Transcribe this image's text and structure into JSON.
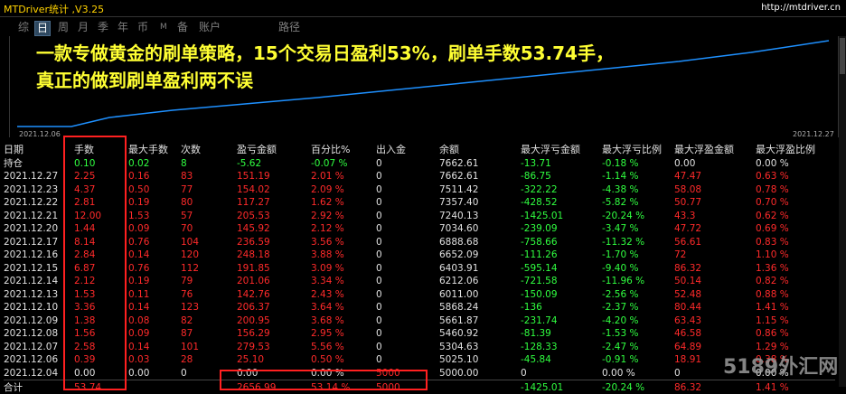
{
  "window": {
    "title": "MTDriver统计 ,V3.25",
    "url": "http://mtdriver.cn"
  },
  "tabs": [
    "综",
    "日",
    "周",
    "月",
    "季",
    "年",
    "币",
    "M",
    "备",
    "账户",
    "路径"
  ],
  "active_tab_index": 1,
  "chart": {
    "start_date": "2021.12.06",
    "end_date": "2021.12.27",
    "line_color": "#1e90ff"
  },
  "banner": {
    "line1": "一款专做黄金的刷单策略，15个交易日盈利53%，刷单手数53.74手，",
    "line2": "真正的做到刷单盈利两不误"
  },
  "table": {
    "headers": [
      "日期",
      "手数",
      "最大手数",
      "次数",
      "盈亏金额",
      "百分比%",
      "出入金",
      "余额",
      "最大浮亏金额",
      "最大浮亏比例",
      "最大浮盈金额",
      "最大浮盈比例"
    ],
    "holding": [
      "持仓",
      "0.10",
      "0.02",
      "8",
      "-5.62",
      "-0.07 %",
      "0",
      "7662.61",
      "-13.71",
      "-0.18 %",
      "0.00",
      "0.00 %"
    ],
    "rows": [
      [
        "2021.12.27",
        "2.25",
        "0.16",
        "83",
        "151.19",
        "2.01 %",
        "0",
        "7662.61",
        "-86.75",
        "-1.14 %",
        "47.47",
        "0.63 %"
      ],
      [
        "2021.12.23",
        "4.37",
        "0.50",
        "77",
        "154.02",
        "2.09 %",
        "0",
        "7511.42",
        "-322.22",
        "-4.38 %",
        "58.08",
        "0.78 %"
      ],
      [
        "2021.12.22",
        "2.81",
        "0.19",
        "80",
        "117.27",
        "1.62 %",
        "0",
        "7357.40",
        "-428.52",
        "-5.82 %",
        "50.77",
        "0.70 %"
      ],
      [
        "2021.12.21",
        "12.00",
        "1.53",
        "57",
        "205.53",
        "2.92 %",
        "0",
        "7240.13",
        "-1425.01",
        "-20.24 %",
        "43.3",
        "0.62 %"
      ],
      [
        "2021.12.20",
        "1.44",
        "0.09",
        "70",
        "145.92",
        "2.12 %",
        "0",
        "7034.60",
        "-239.09",
        "-3.47 %",
        "47.72",
        "0.69 %"
      ],
      [
        "2021.12.17",
        "8.14",
        "0.76",
        "104",
        "236.59",
        "3.56 %",
        "0",
        "6888.68",
        "-758.66",
        "-11.32 %",
        "56.61",
        "0.83 %"
      ],
      [
        "2021.12.16",
        "2.84",
        "0.14",
        "120",
        "248.18",
        "3.88 %",
        "0",
        "6652.09",
        "-111.26",
        "-1.70 %",
        "72",
        "1.10 %"
      ],
      [
        "2021.12.15",
        "6.87",
        "0.76",
        "112",
        "191.85",
        "3.09 %",
        "0",
        "6403.91",
        "-595.14",
        "-9.40 %",
        "86.32",
        "1.36 %"
      ],
      [
        "2021.12.14",
        "2.12",
        "0.19",
        "79",
        "201.06",
        "3.34 %",
        "0",
        "6212.06",
        "-721.58",
        "-11.96 %",
        "50.14",
        "0.82 %"
      ],
      [
        "2021.12.13",
        "1.53",
        "0.11",
        "76",
        "142.76",
        "2.43 %",
        "0",
        "6011.00",
        "-150.09",
        "-2.56 %",
        "52.48",
        "0.88 %"
      ],
      [
        "2021.12.10",
        "3.36",
        "0.14",
        "123",
        "206.37",
        "3.64 %",
        "0",
        "5868.24",
        "-136",
        "-2.37 %",
        "80.44",
        "1.41 %"
      ],
      [
        "2021.12.09",
        "1.38",
        "0.08",
        "82",
        "200.95",
        "3.68 %",
        "0",
        "5661.87",
        "-231.74",
        "-4.20 %",
        "63.43",
        "1.15 %"
      ],
      [
        "2021.12.08",
        "1.56",
        "0.09",
        "87",
        "156.29",
        "2.95 %",
        "0",
        "5460.92",
        "-81.39",
        "-1.53 %",
        "46.58",
        "0.86 %"
      ],
      [
        "2021.12.07",
        "2.58",
        "0.14",
        "101",
        "279.53",
        "5.56 %",
        "0",
        "5304.63",
        "-128.33",
        "-2.47 %",
        "64.89",
        "1.29 %"
      ],
      [
        "2021.12.06",
        "0.39",
        "0.03",
        "28",
        "25.10",
        "0.50 %",
        "0",
        "5025.10",
        "-45.84",
        "-0.91 %",
        "18.91",
        "0.38 %"
      ],
      [
        "2021.12.04",
        "0.00",
        "0.00",
        "0",
        "0.00",
        "0.00 %",
        "5000",
        "5000.00",
        "0",
        "0.00 %",
        "0",
        "0.00 %"
      ]
    ],
    "total": [
      "合计",
      "53.74",
      "",
      "",
      "2656.99",
      "53.14 %",
      "5000",
      "",
      "-1425.01",
      "-20.24 %",
      "86.32",
      "1.41 %"
    ]
  },
  "watermark": "5189外汇网"
}
